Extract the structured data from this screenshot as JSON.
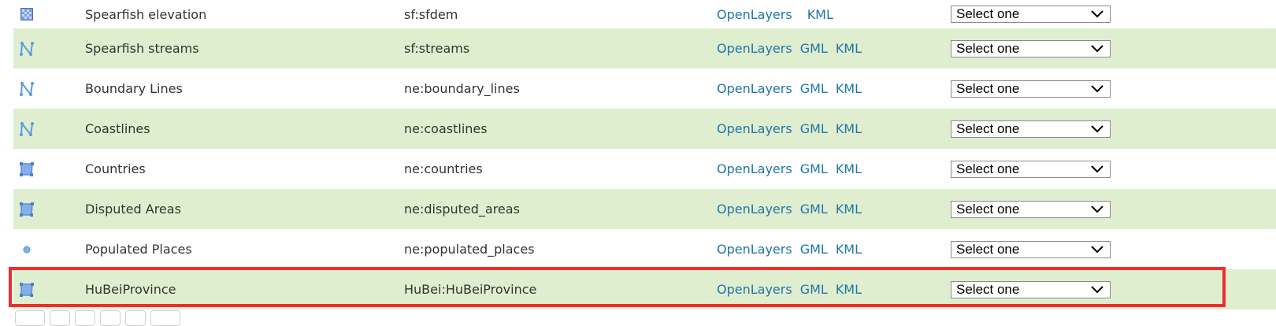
{
  "layers": [
    {
      "type_icon": "raster-icon",
      "title": "Spearfish elevation",
      "name": "sf:sfdem",
      "links": [
        "OpenLayers",
        "KML"
      ],
      "select": "Select one"
    },
    {
      "type_icon": "line-icon",
      "title": "Spearfish streams",
      "name": "sf:streams",
      "links": [
        "OpenLayers",
        "GML",
        "KML"
      ],
      "select": "Select one"
    },
    {
      "type_icon": "line-icon",
      "title": "Boundary Lines",
      "name": "ne:boundary_lines",
      "links": [
        "OpenLayers",
        "GML",
        "KML"
      ],
      "select": "Select one"
    },
    {
      "type_icon": "line-icon",
      "title": "Coastlines",
      "name": "ne:coastlines",
      "links": [
        "OpenLayers",
        "GML",
        "KML"
      ],
      "select": "Select one"
    },
    {
      "type_icon": "polygon-icon",
      "title": "Countries",
      "name": "ne:countries",
      "links": [
        "OpenLayers",
        "GML",
        "KML"
      ],
      "select": "Select one"
    },
    {
      "type_icon": "polygon-icon",
      "title": "Disputed Areas",
      "name": "ne:disputed_areas",
      "links": [
        "OpenLayers",
        "GML",
        "KML"
      ],
      "select": "Select one"
    },
    {
      "type_icon": "point-icon",
      "title": "Populated Places",
      "name": "ne:populated_places",
      "links": [
        "OpenLayers",
        "GML",
        "KML"
      ],
      "select": "Select one"
    },
    {
      "type_icon": "polygon-icon",
      "title": "HuBeiProvince",
      "name": "HuBei:HuBeiProvince",
      "links": [
        "OpenLayers",
        "GML",
        "KML"
      ],
      "select": "Select one"
    }
  ],
  "highlight_color": "#ee2d2d",
  "odd_row_color": "#e0eed0",
  "link_color": "#1f75a8"
}
